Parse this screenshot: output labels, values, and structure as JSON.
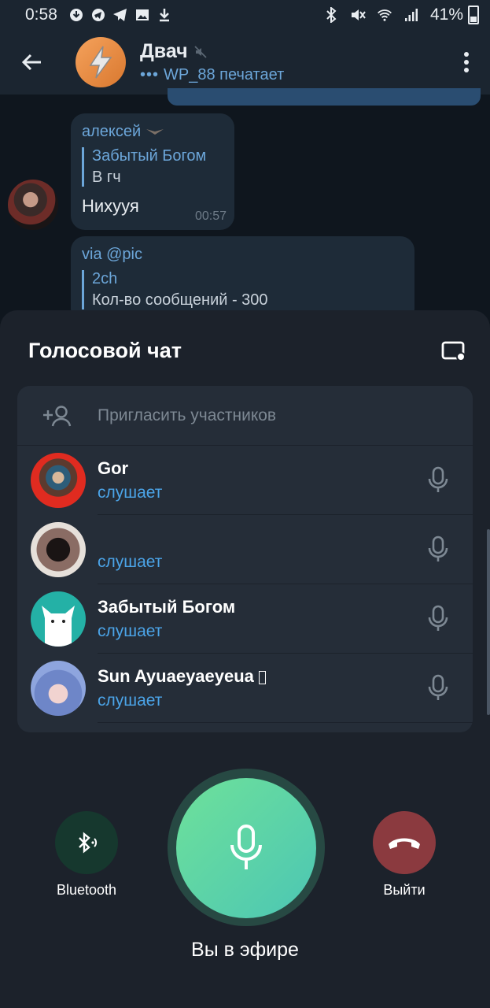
{
  "status_bar": {
    "time": "0:58",
    "battery": "41%"
  },
  "chat": {
    "title": "Двач",
    "typing_status": "WP_88 печатает",
    "outgoing_time": "00:57"
  },
  "message": {
    "sender": "алексей",
    "reply_name": "Забытый Богом",
    "reply_text": "В гч",
    "text": "Нихууя",
    "time": "00:57"
  },
  "message2": {
    "via": "via @pic",
    "reply_name": "2ch",
    "reply_text": "Кол-во сообщений - 300"
  },
  "voice_chat": {
    "title": "Голосовой чат",
    "invite_label": "Пригласить участников",
    "participants": [
      {
        "name": "Gor",
        "status": "слушает"
      },
      {
        "name": "",
        "status": "слушает"
      },
      {
        "name": "Забытый Богом",
        "status": "слушает"
      },
      {
        "name": "Sun Ayuaeyaeyeua",
        "status": "слушает"
      }
    ],
    "bluetooth_label": "Bluetooth",
    "leave_label": "Выйти",
    "on_air_label": "Вы в эфире"
  },
  "colors": {
    "accent": "#4ba4e8",
    "mic_active": "#5fd6a6",
    "leave": "#8b3a3f"
  }
}
